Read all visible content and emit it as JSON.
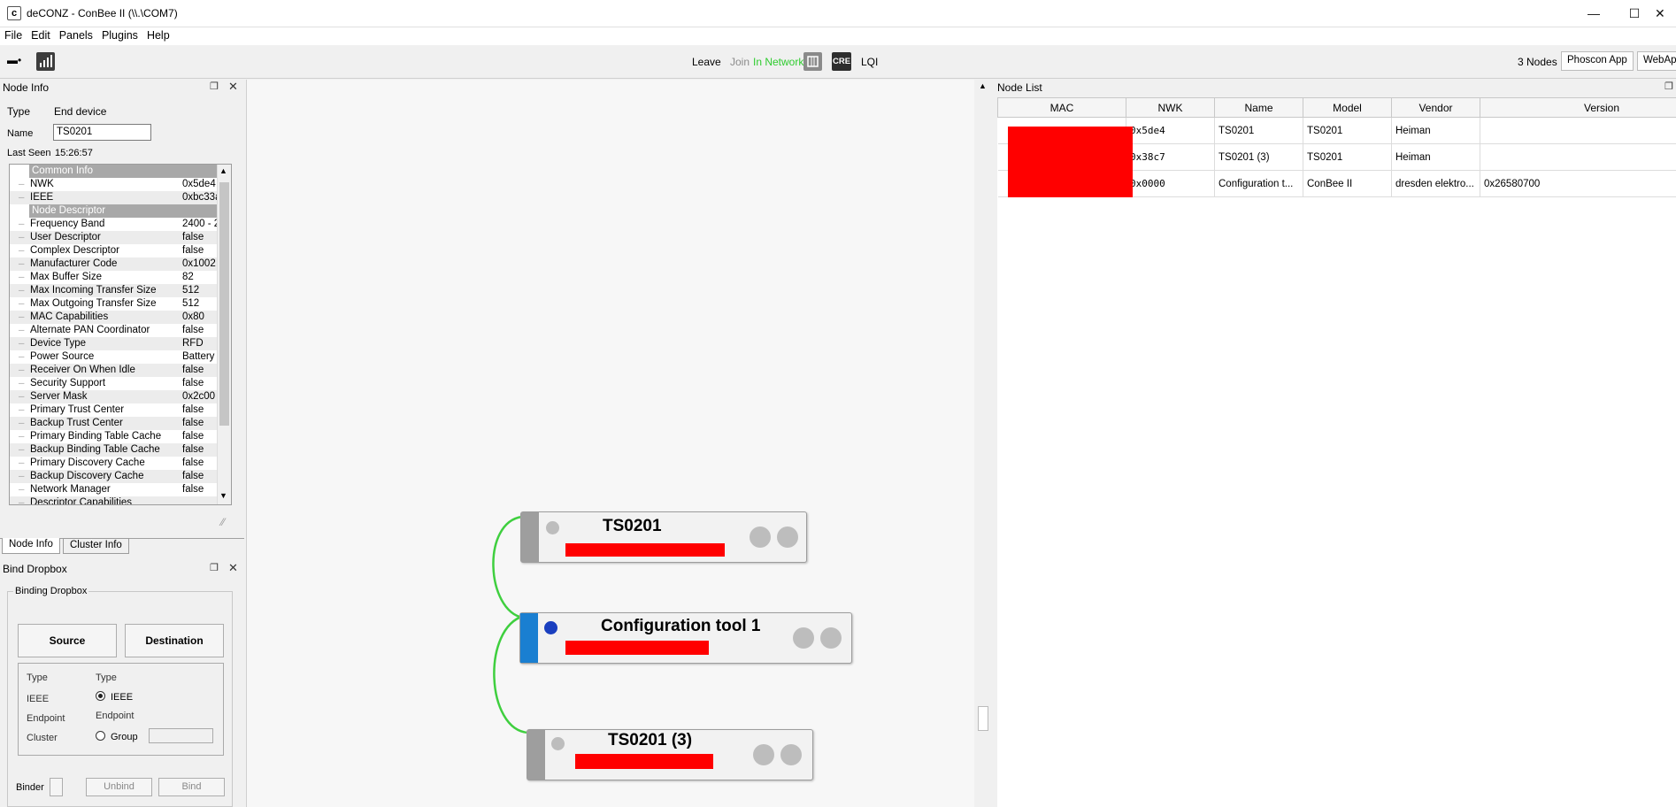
{
  "window": {
    "title": "deCONZ - ConBee II (\\\\.\\COM7)",
    "app_icon": "c"
  },
  "menu": [
    "File",
    "Edit",
    "Panels",
    "Plugins",
    "Help"
  ],
  "toolbar": {
    "leave": "Leave",
    "join": "Join",
    "status": "In Network",
    "status_color": "#2ecc2e",
    "cre": "CRE",
    "lqi": "LQI",
    "nodes_count": "3 Nodes",
    "phoscon_btn": "Phoscon App",
    "webapp_btn": "WebApp"
  },
  "node_info": {
    "panel_title": "Node Info",
    "type_label": "Type",
    "type_value": "End device",
    "name_label": "Name",
    "name_value": "TS0201",
    "last_seen_label": "Last Seen",
    "last_seen_value": "15:26:57",
    "common_header": "Common Info",
    "common_rows": [
      {
        "key": "NWK",
        "value": "0x5de4"
      },
      {
        "key": "IEEE",
        "value": "0xbc33a"
      }
    ],
    "descriptor_header": "Node Descriptor",
    "descriptor_rows": [
      {
        "key": "Frequency Band",
        "value": "2400 - 2"
      },
      {
        "key": "User Descriptor",
        "value": "false"
      },
      {
        "key": "Complex Descriptor",
        "value": "false"
      },
      {
        "key": "Manufacturer Code",
        "value": "0x1002"
      },
      {
        "key": "Max Buffer Size",
        "value": "82"
      },
      {
        "key": "Max Incoming Transfer Size",
        "value": "512"
      },
      {
        "key": "Max Outgoing Transfer Size",
        "value": "512"
      },
      {
        "key": "MAC Capabilities",
        "value": "0x80"
      },
      {
        "key": "Alternate PAN Coordinator",
        "value": "false"
      },
      {
        "key": "Device Type",
        "value": "RFD"
      },
      {
        "key": "Power Source",
        "value": "Battery"
      },
      {
        "key": "Receiver On When Idle",
        "value": "false"
      },
      {
        "key": "Security Support",
        "value": "false"
      },
      {
        "key": "Server Mask",
        "value": "0x2c00"
      },
      {
        "key": "Primary Trust Center",
        "value": "false"
      },
      {
        "key": "Backup Trust Center",
        "value": "false"
      },
      {
        "key": "Primary Binding Table Cache",
        "value": "false"
      },
      {
        "key": "Backup Binding Table Cache",
        "value": "false"
      },
      {
        "key": "Primary Discovery Cache",
        "value": "false"
      },
      {
        "key": "Backup Discovery Cache",
        "value": "false"
      },
      {
        "key": "Network Manager",
        "value": "false"
      },
      {
        "key": "Descriptor Capabilities",
        "value": ""
      }
    ],
    "tabs": [
      "Node Info",
      "Cluster Info"
    ]
  },
  "bind_dropbox": {
    "panel_title": "Bind Dropbox",
    "group_title": "Binding Dropbox",
    "source_btn": "Source",
    "destination_btn": "Destination",
    "left_labels": [
      "Type",
      "IEEE",
      "Endpoint",
      "Cluster"
    ],
    "right_type": "Type",
    "radio_ieee": "IEEE",
    "right_endpoint": "Endpoint",
    "radio_group": "Group",
    "binder_label": "Binder",
    "unbind_btn": "Unbind",
    "bind_btn": "Bind"
  },
  "canvas": {
    "nodes": [
      {
        "name": "TS0201",
        "strip_color": "#9e9e9e",
        "dot_color": "#bdbdbd"
      },
      {
        "name": "Configuration tool 1",
        "strip_color": "#1a7fd1",
        "dot_color": "#1a3fbf"
      },
      {
        "name": "TS0201 (3)",
        "strip_color": "#9e9e9e",
        "dot_color": "#bdbdbd"
      }
    ],
    "link_color": "#3fcf3f"
  },
  "node_list": {
    "panel_title": "Node List",
    "columns": [
      "MAC",
      "NWK",
      "Name",
      "Model",
      "Vendor",
      "Version"
    ],
    "rows": [
      {
        "nwk": "0x5de4",
        "name": "TS0201",
        "model": "TS0201",
        "vendor": "Heiman",
        "version": ""
      },
      {
        "nwk": "0x38c7",
        "name": "TS0201 (3)",
        "model": "TS0201",
        "vendor": "Heiman",
        "version": ""
      },
      {
        "nwk": "0x0000",
        "name": "Configuration t...",
        "model": "ConBee II",
        "vendor": "dresden elektro...",
        "version": "0x26580700"
      }
    ]
  }
}
